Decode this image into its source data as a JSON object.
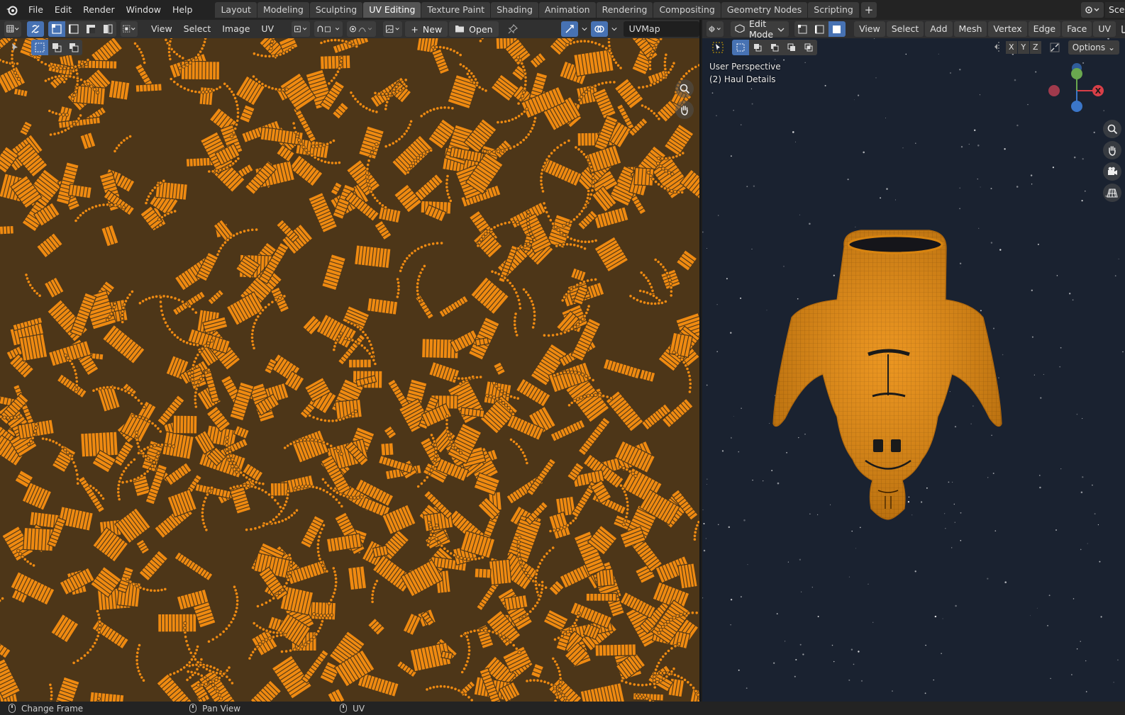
{
  "app": {
    "menus": [
      "File",
      "Edit",
      "Render",
      "Window",
      "Help"
    ],
    "workspaces": [
      "Layout",
      "Modeling",
      "Sculpting",
      "UV Editing",
      "Texture Paint",
      "Shading",
      "Animation",
      "Rendering",
      "Compositing",
      "Geometry Nodes",
      "Scripting"
    ],
    "active_workspace": "UV Editing",
    "add_workspace": "+",
    "scene_name": "Scen"
  },
  "uv_editor": {
    "menus": [
      "View",
      "Select",
      "Image",
      "UV"
    ],
    "new_label": "New",
    "open_label": "Open",
    "uv_map": "UVMap"
  },
  "viewport": {
    "mode": "Edit Mode",
    "menus": [
      "View",
      "Select",
      "Add",
      "Mesh",
      "Vertex",
      "Edge",
      "Face",
      "UV"
    ],
    "axes": [
      "X",
      "Y",
      "Z"
    ],
    "options_label": "Options",
    "perspective_label": "User Perspective",
    "object_label": "(2) Haul Details",
    "gizmo_x": "X"
  },
  "statusbar": {
    "items": [
      "Change Frame",
      "Pan View",
      "UV"
    ]
  },
  "colors": {
    "uv_orange": "#ef8a11",
    "uv_dark": "#4d3618",
    "mesh_orange": "#e58d14",
    "accent_blue": "#4772b3"
  }
}
